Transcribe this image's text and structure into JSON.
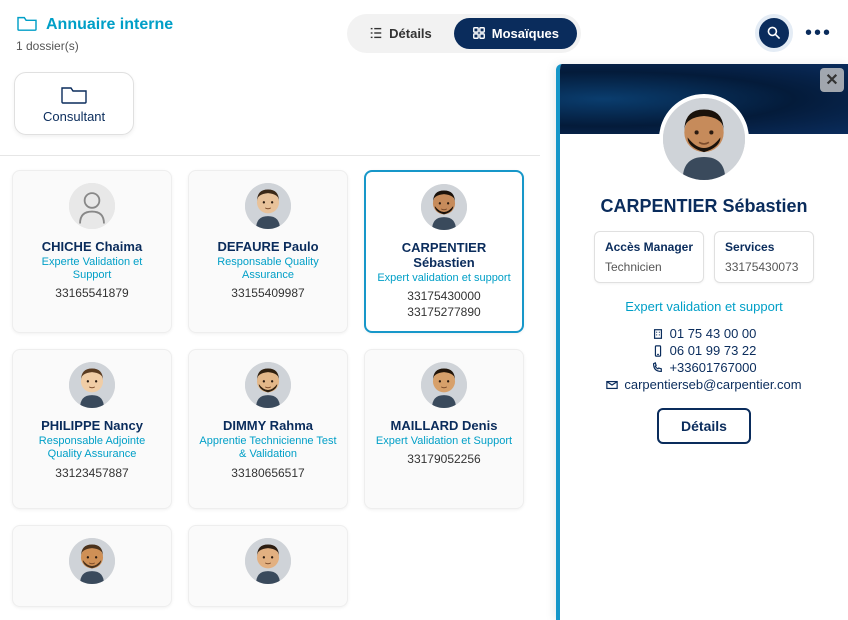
{
  "header": {
    "title": "Annuaire interne",
    "folder_count": "1 dossier(s)"
  },
  "view": {
    "details_label": "Détails",
    "mosaic_label": "Mosaïques"
  },
  "filter": {
    "label": "Consultant"
  },
  "cards": [
    {
      "name": "CHICHE Chaima",
      "role": "Experte Validation et Support",
      "extras": [
        "33165541879"
      ],
      "placeholder": true,
      "selected": false
    },
    {
      "name": "DEFAURE Paulo",
      "role": "Responsable Quality Assurance",
      "extras": [
        "33155409987"
      ],
      "placeholder": false,
      "selected": false
    },
    {
      "name": "CARPENTIER Sébastien",
      "role": "Expert validation et support",
      "extras": [
        "33175430000",
        "33175277890"
      ],
      "placeholder": false,
      "selected": true
    },
    {
      "name": "PHILIPPE Nancy",
      "role": "Responsable Adjointe Quality Assurance",
      "extras": [
        "33123457887"
      ],
      "placeholder": false,
      "selected": false
    },
    {
      "name": "DIMMY Rahma",
      "role": "Apprentie Technicienne Test & Validation",
      "extras": [
        "33180656517"
      ],
      "placeholder": false,
      "selected": false
    },
    {
      "name": "MAILLARD Denis",
      "role": "Expert Validation et Support",
      "extras": [
        "33179052256"
      ],
      "placeholder": false,
      "selected": false
    }
  ],
  "panel": {
    "name": "CARPENTIER Sébastien",
    "boxes": [
      {
        "label": "Accès Manager",
        "value": "Technicien"
      },
      {
        "label": "Services",
        "value": "33175430073"
      }
    ],
    "role": "Expert validation et support",
    "phone_office": "01 75 43 00 00",
    "phone_mobile": "06 01 99 73 22",
    "phone_intl": "+33601767000",
    "email": "carpentierseb@carpentier.com",
    "details_button": "Détails"
  },
  "avatar_colors": {
    "placeholder_bg": "#e8e8e8",
    "placeholder_fg": "#888",
    "skin": [
      "#d9a56b",
      "#e8c29a",
      "#c68b5b",
      "#f0cda6",
      "#e3b788",
      "#d7a06a",
      "#cf9056",
      "#e2b081"
    ],
    "hair": [
      "#2a1a10",
      "#3a2817",
      "#1a120b",
      "#5a3b20",
      "#30200f",
      "#221509",
      "#4a321c",
      "#2d1e12"
    ]
  }
}
